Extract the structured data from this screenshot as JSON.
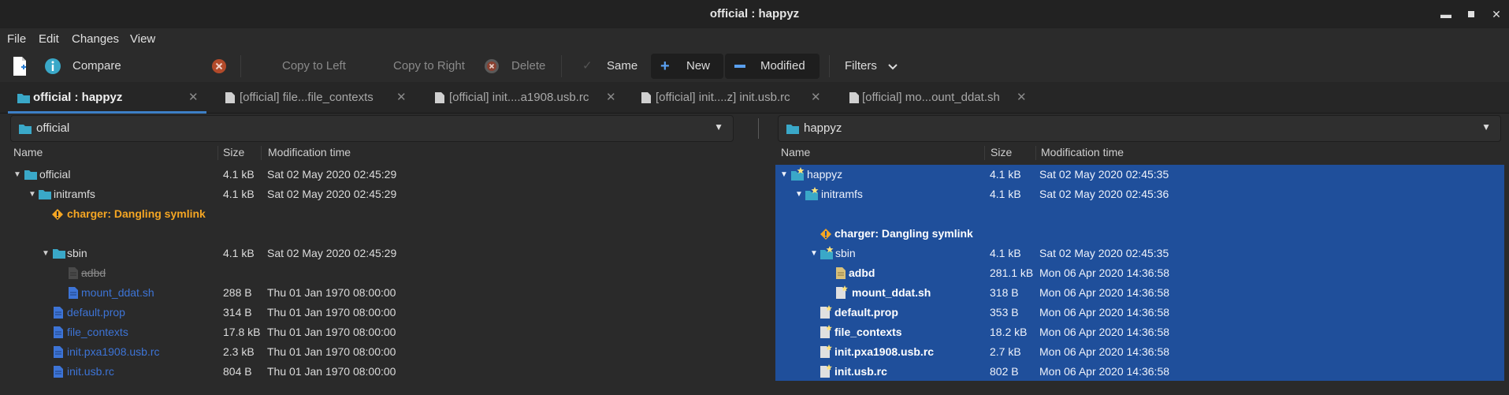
{
  "window": {
    "title": "official : happyz",
    "controls": [
      "minimize-icon",
      "maximize-icon",
      "close-icon"
    ]
  },
  "menu": [
    "File",
    "Edit",
    "Changes",
    "View"
  ],
  "toolbar": {
    "compare": "Compare",
    "copy_left": "Copy to Left",
    "copy_right": "Copy to Right",
    "delete": "Delete",
    "same": "Same",
    "new": "New",
    "modified": "Modified",
    "filters": "Filters"
  },
  "tabs": [
    {
      "label": "official : happyz",
      "active": true
    },
    {
      "label": "[official] file...file_contexts"
    },
    {
      "label": "[official] init....a1908.usb.rc"
    },
    {
      "label": "[official] init....z] init.usb.rc"
    },
    {
      "label": "[official] mo...ount_ddat.sh"
    }
  ],
  "left": {
    "path": "official",
    "headers": {
      "name": "Name",
      "size": "Size",
      "mtime": "Modification time"
    },
    "rows": [
      {
        "name": "official",
        "size": "4.1 kB",
        "mtime": "Sat 02 May 2020 02:45:29"
      },
      {
        "name": "initramfs",
        "size": "4.1 kB",
        "mtime": "Sat 02 May 2020 02:45:29"
      },
      {
        "name": "charger: Dangling symlink",
        "size": "",
        "mtime": ""
      },
      {
        "name": "sbin",
        "size": "4.1 kB",
        "mtime": "Sat 02 May 2020 02:45:29"
      },
      {
        "name": "adbd",
        "size": "",
        "mtime": ""
      },
      {
        "name": "mount_ddat.sh",
        "size": "288 B",
        "mtime": "Thu 01 Jan 1970 08:00:00"
      },
      {
        "name": "default.prop",
        "size": "314 B",
        "mtime": "Thu 01 Jan 1970 08:00:00"
      },
      {
        "name": "file_contexts",
        "size": "17.8 kB",
        "mtime": "Thu 01 Jan 1970 08:00:00"
      },
      {
        "name": "init.pxa1908.usb.rc",
        "size": "2.3 kB",
        "mtime": "Thu 01 Jan 1970 08:00:00"
      },
      {
        "name": "init.usb.rc",
        "size": "804 B",
        "mtime": "Thu 01 Jan 1970 08:00:00"
      }
    ]
  },
  "right": {
    "path": "happyz",
    "headers": {
      "name": "Name",
      "size": "Size",
      "mtime": "Modification time"
    },
    "rows": [
      {
        "name": "happyz",
        "size": "4.1 kB",
        "mtime": "Sat 02 May 2020 02:45:35"
      },
      {
        "name": "initramfs",
        "size": "4.1 kB",
        "mtime": "Sat 02 May 2020 02:45:36"
      },
      {
        "name": "charger: Dangling symlink",
        "size": "",
        "mtime": ""
      },
      {
        "name": "sbin",
        "size": "4.1 kB",
        "mtime": "Sat 02 May 2020 02:45:35"
      },
      {
        "name": "adbd",
        "size": "281.1 kB",
        "mtime": "Mon 06 Apr 2020 14:36:58"
      },
      {
        "name": "mount_ddat.sh",
        "size": "318 B",
        "mtime": "Mon 06 Apr 2020 14:36:58"
      },
      {
        "name": "default.prop",
        "size": "353 B",
        "mtime": "Mon 06 Apr 2020 14:36:58"
      },
      {
        "name": "file_contexts",
        "size": "18.2 kB",
        "mtime": "Mon 06 Apr 2020 14:36:58"
      },
      {
        "name": "init.pxa1908.usb.rc",
        "size": "2.7 kB",
        "mtime": "Mon 06 Apr 2020 14:36:58"
      },
      {
        "name": "init.usb.rc",
        "size": "802 B",
        "mtime": "Mon 06 Apr 2020 14:36:58"
      }
    ]
  },
  "colors": {
    "accent": "#3d7fc6",
    "selection": "#1f4f9b",
    "folder": "#3aa8c8",
    "missing": "#3d74d6",
    "error": "#f5a623",
    "background": "#2a2a2a"
  }
}
